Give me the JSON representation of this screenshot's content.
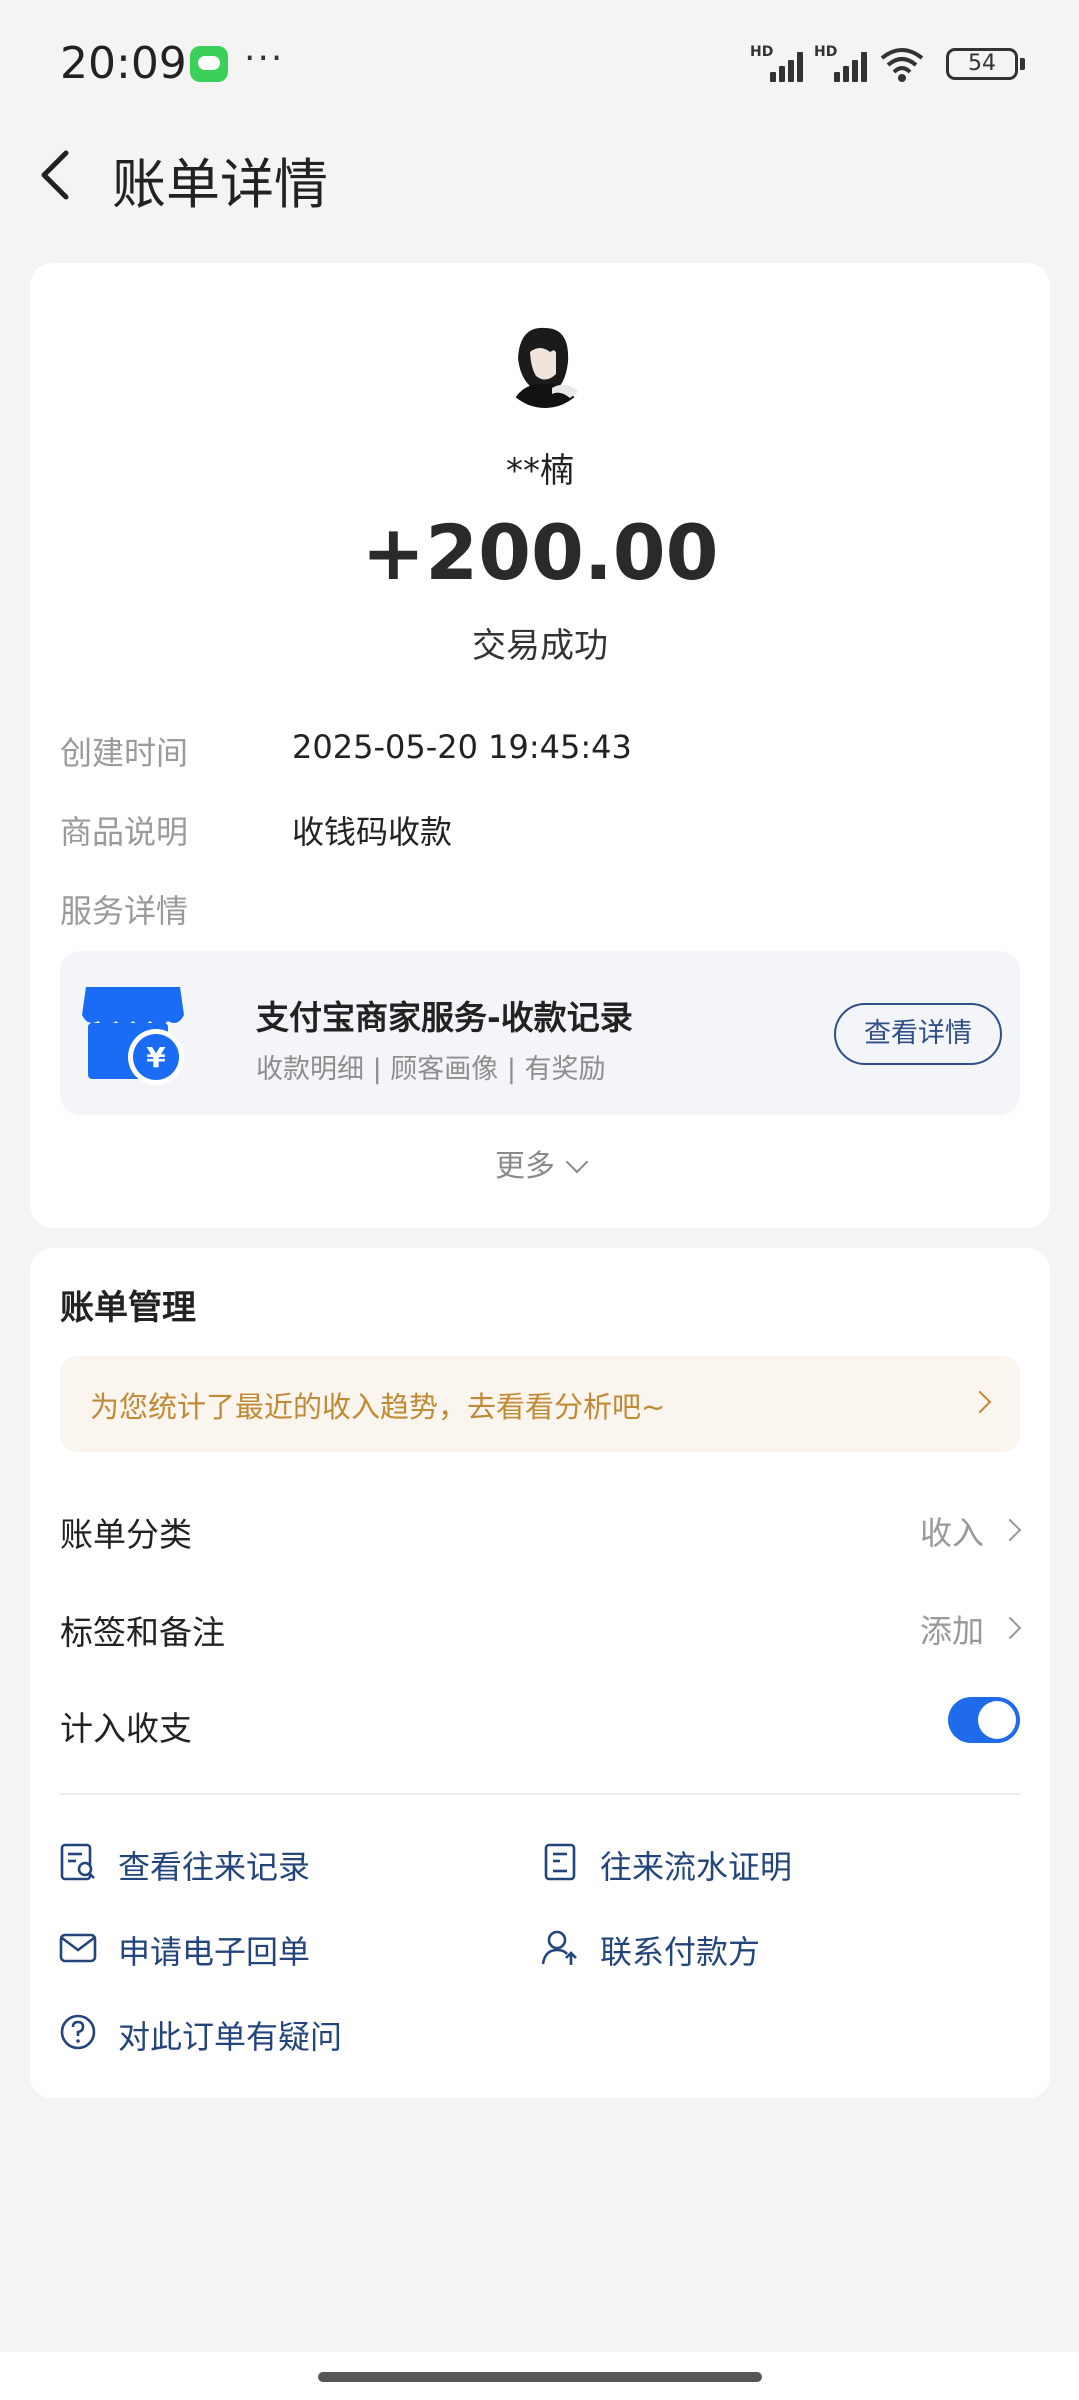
{
  "status_bar": {
    "time": "20:09",
    "more": "···",
    "signal1_label": "HD",
    "signal2_label": "HD",
    "battery": "54"
  },
  "header": {
    "title": "账单详情"
  },
  "transaction": {
    "payer_name": "**楠",
    "amount": "+200.00",
    "status": "交易成功",
    "created_label": "创建时间",
    "created_value": "2025-05-20 19:45:43",
    "product_label": "商品说明",
    "product_value": "收钱码收款",
    "service_label": "服务详情"
  },
  "service": {
    "title": "支付宝商家服务-收款记录",
    "subtitle": "收款明细 | 顾客画像 | 有奖励",
    "button": "查看详情"
  },
  "more": "更多",
  "management": {
    "title": "账单管理",
    "banner": "为您统计了最近的收入趋势，去看看分析吧~",
    "category_label": "账单分类",
    "category_value": "收入",
    "tags_label": "标签和备注",
    "tags_value": "添加",
    "include_label": "计入收支",
    "include_on": true
  },
  "links": {
    "records": "查看往来记录",
    "statement": "往来流水证明",
    "receipt": "申请电子回单",
    "contact": "联系付款方",
    "question": "对此订单有疑问"
  },
  "colors": {
    "accent": "#1f6bec",
    "link": "#24457c",
    "banner_text": "#c08a35",
    "banner_bg": "#fbf5ef",
    "service_icon": "#1a6cf5"
  }
}
